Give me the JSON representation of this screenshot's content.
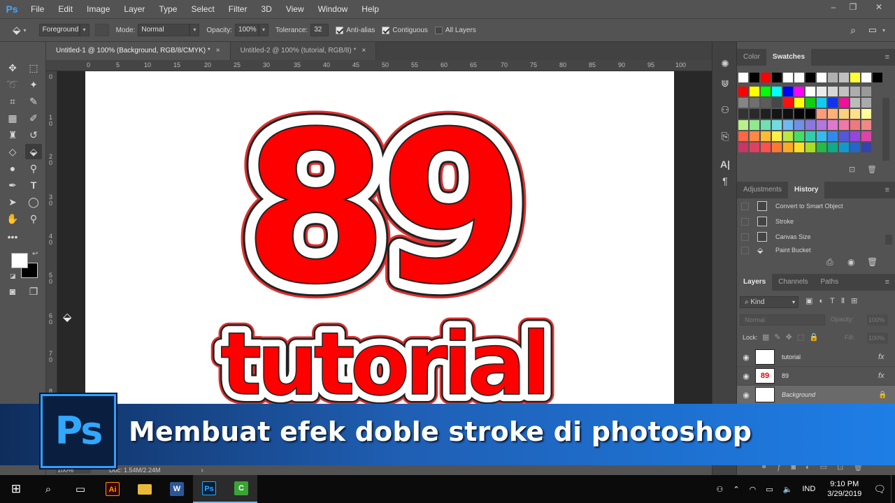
{
  "app": {
    "logo": "Ps"
  },
  "menu": [
    "File",
    "Edit",
    "Image",
    "Layer",
    "Type",
    "Select",
    "Filter",
    "3D",
    "View",
    "Window",
    "Help"
  ],
  "window_controls": {
    "minimize": "–",
    "restore": "❐",
    "close": "✕"
  },
  "options": {
    "fill_source": "Foreground",
    "mode_label": "Mode:",
    "mode_value": "Normal",
    "opacity_label": "Opacity:",
    "opacity_value": "100%",
    "tolerance_label": "Tolerance:",
    "tolerance_value": "32",
    "antialias_label": "Anti-alias",
    "contiguous_label": "Contiguous",
    "all_layers_label": "All Layers"
  },
  "tabs": [
    {
      "label": "Untitled-1 @ 100% (Background, RGB/8/CMYK) *",
      "close": "×"
    },
    {
      "label": "Untitled-2 @ 100% (tutorial, RGB/8) *",
      "close": "×"
    }
  ],
  "ruler_top": [
    "0",
    "5",
    "10",
    "15",
    "20",
    "25",
    "30",
    "35",
    "40",
    "45",
    "50",
    "55",
    "60",
    "65",
    "70",
    "75",
    "80",
    "85",
    "90",
    "95",
    "100"
  ],
  "ruler_left": [
    "0",
    "1\n0",
    "2\n0",
    "3\n0",
    "4\n0",
    "5\n0",
    "6\n0",
    "7\n0",
    "8"
  ],
  "canvas_text": {
    "big": "89",
    "word": "tutorial"
  },
  "color_panel": {
    "tabs": [
      "Color",
      "Swatches"
    ]
  },
  "swatch_colors": {
    "row0": [
      "#ffffff",
      "#000000",
      "#ff0000",
      "#000000",
      "#ffffff",
      "#ffffff",
      "#000000",
      "#ffffff",
      "#b0b0b0",
      "#c0c0c0",
      "#ffff33",
      "#ffffff",
      "#000000"
    ],
    "row1": [
      "#ff0000",
      "#ffff00",
      "#00ff00",
      "#00ffff",
      "#0000ff",
      "#ff00ff",
      "#ffffff",
      "#ebebeb",
      "#d6d6d6",
      "#c2c2c2",
      "#adadad",
      "#999999"
    ],
    "row2": [
      "#858585",
      "#707070",
      "#5c5c5c",
      "#474747",
      "#ff1010",
      "#ffff11",
      "#11cc11",
      "#11ccee",
      "#1133ee",
      "#ee1199",
      "#bbbbbb",
      "#aaaaaa"
    ],
    "row3": [
      "#333333",
      "#2a2a2a",
      "#202020",
      "#151515",
      "#101010",
      "#050505",
      "#000000",
      "#ff9a7a",
      "#ffb07a",
      "#ffd07a",
      "#ffe08a",
      "#ffff99"
    ],
    "row4": [
      "#b8f08a",
      "#90e890",
      "#70e0b0",
      "#70dce0",
      "#70b8f0",
      "#7090e8",
      "#8878e0",
      "#b078e0",
      "#e078d0",
      "#f078a8",
      "#f07880",
      "#f08888"
    ],
    "row5": [
      "#ff6644",
      "#ff8844",
      "#ffbb33",
      "#ffee44",
      "#b8e844",
      "#44dd66",
      "#33ccaa",
      "#33bbee",
      "#3388ee",
      "#5555dd",
      "#9944dd",
      "#dd44aa"
    ],
    "row6": [
      "#cc3366",
      "#e04060",
      "#ff5050",
      "#ff7733",
      "#ffaa22",
      "#ffdd22",
      "#a8dd22",
      "#22bb44",
      "#11aa88",
      "#1199cc",
      "#2266cc",
      "#3344aa"
    ]
  },
  "history_panel": {
    "tabs": [
      "Adjustments",
      "History"
    ],
    "items": [
      "Convert to Smart Object",
      "Stroke",
      "Canvas Size",
      "Paint Bucket"
    ]
  },
  "layers_panel": {
    "tabs": [
      "Layers",
      "Channels",
      "Paths"
    ],
    "filter": "Kind",
    "blend": "Normal",
    "opacity_label": "Opacity:",
    "opacity_value": "100%",
    "lock_label": "Lock:",
    "fill_label": "Fill:",
    "fill_value": "100%",
    "layers": [
      {
        "name": "tutorial",
        "fx": "fx"
      },
      {
        "name": "89",
        "fx": "fx"
      },
      {
        "name": "Background",
        "fx": ""
      }
    ]
  },
  "status": {
    "zoom": "100%",
    "doc": "Doc: 1.54M/2.24M"
  },
  "banner": {
    "title": "Membuat efek doble stroke di photoshop",
    "badge": "Ps"
  },
  "taskbar": {
    "apps": [
      {
        "name": "illustrator",
        "label": "Ai",
        "color": "#ff9a00",
        "bg": "#330000"
      },
      {
        "name": "explorer",
        "label": "▬",
        "color": "#ffd75e",
        "bg": "transparent"
      },
      {
        "name": "word",
        "label": "W",
        "color": "#ffffff",
        "bg": "#2b579a"
      },
      {
        "name": "photoshop",
        "label": "Ps",
        "color": "#31a8ff",
        "bg": "#001e36"
      },
      {
        "name": "camtasia",
        "label": "C",
        "color": "#ffffff",
        "bg": "#3aa335"
      }
    ],
    "lang": "IND",
    "time": "9:10 PM",
    "date": "3/29/2019"
  }
}
